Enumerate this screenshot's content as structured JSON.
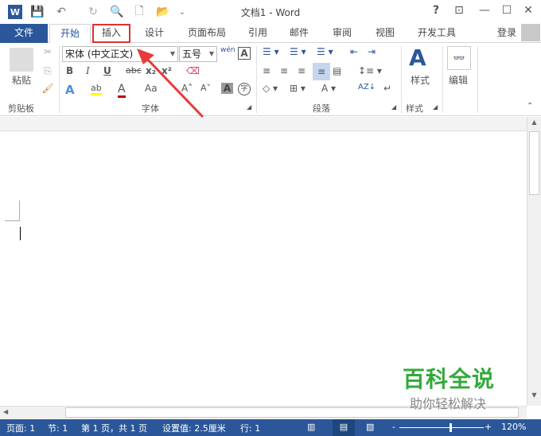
{
  "window": {
    "title": "文档1 - Word",
    "help": "?",
    "restore_ribbon": "⊡",
    "minimize": "—",
    "maximize": "☐",
    "close": "✕"
  },
  "quick_access": {
    "app_icon": "W",
    "save": "💾",
    "undo": "↶",
    "redo": "↻",
    "preview": "🔍",
    "new": "🗋",
    "open": "📂",
    "customize": "⌄"
  },
  "tabs": [
    "文件",
    "开始",
    "插入",
    "设计",
    "页面布局",
    "引用",
    "邮件",
    "审阅",
    "视图",
    "开发工具"
  ],
  "signin": "登录",
  "ribbon": {
    "clipboard": {
      "paste": "粘贴",
      "label": "剪贴板"
    },
    "font": {
      "name": "宋体 (中文正文)",
      "size": "五号",
      "bold": "B",
      "italic": "I",
      "underline": "U",
      "strike": "abc",
      "subscript": "x₂",
      "superscript": "x²",
      "case": "Aa",
      "grow": "A˄",
      "shrink": "A˅",
      "label": "字体",
      "phonetic": "wén",
      "char_border": "A",
      "char_shading": "A",
      "enclose": "字"
    },
    "paragraph": {
      "label": "段落"
    },
    "styles": {
      "button": "样式",
      "label": "样式"
    },
    "editing": {
      "button": "编辑"
    }
  },
  "statusbar": {
    "page": "页面: 1",
    "section": "节: 1",
    "page_of": "第 1 页，共 1 页",
    "setting": "设置值: 2.5厘米",
    "line": "行: 1",
    "zoom": "120%",
    "zoom_level": 120
  },
  "watermark": {
    "title": "百科全说",
    "subtitle": "助你轻松解决"
  },
  "colors": {
    "accent": "#2b579a",
    "highlight": "#e03030",
    "watermark": "#33a93a"
  }
}
